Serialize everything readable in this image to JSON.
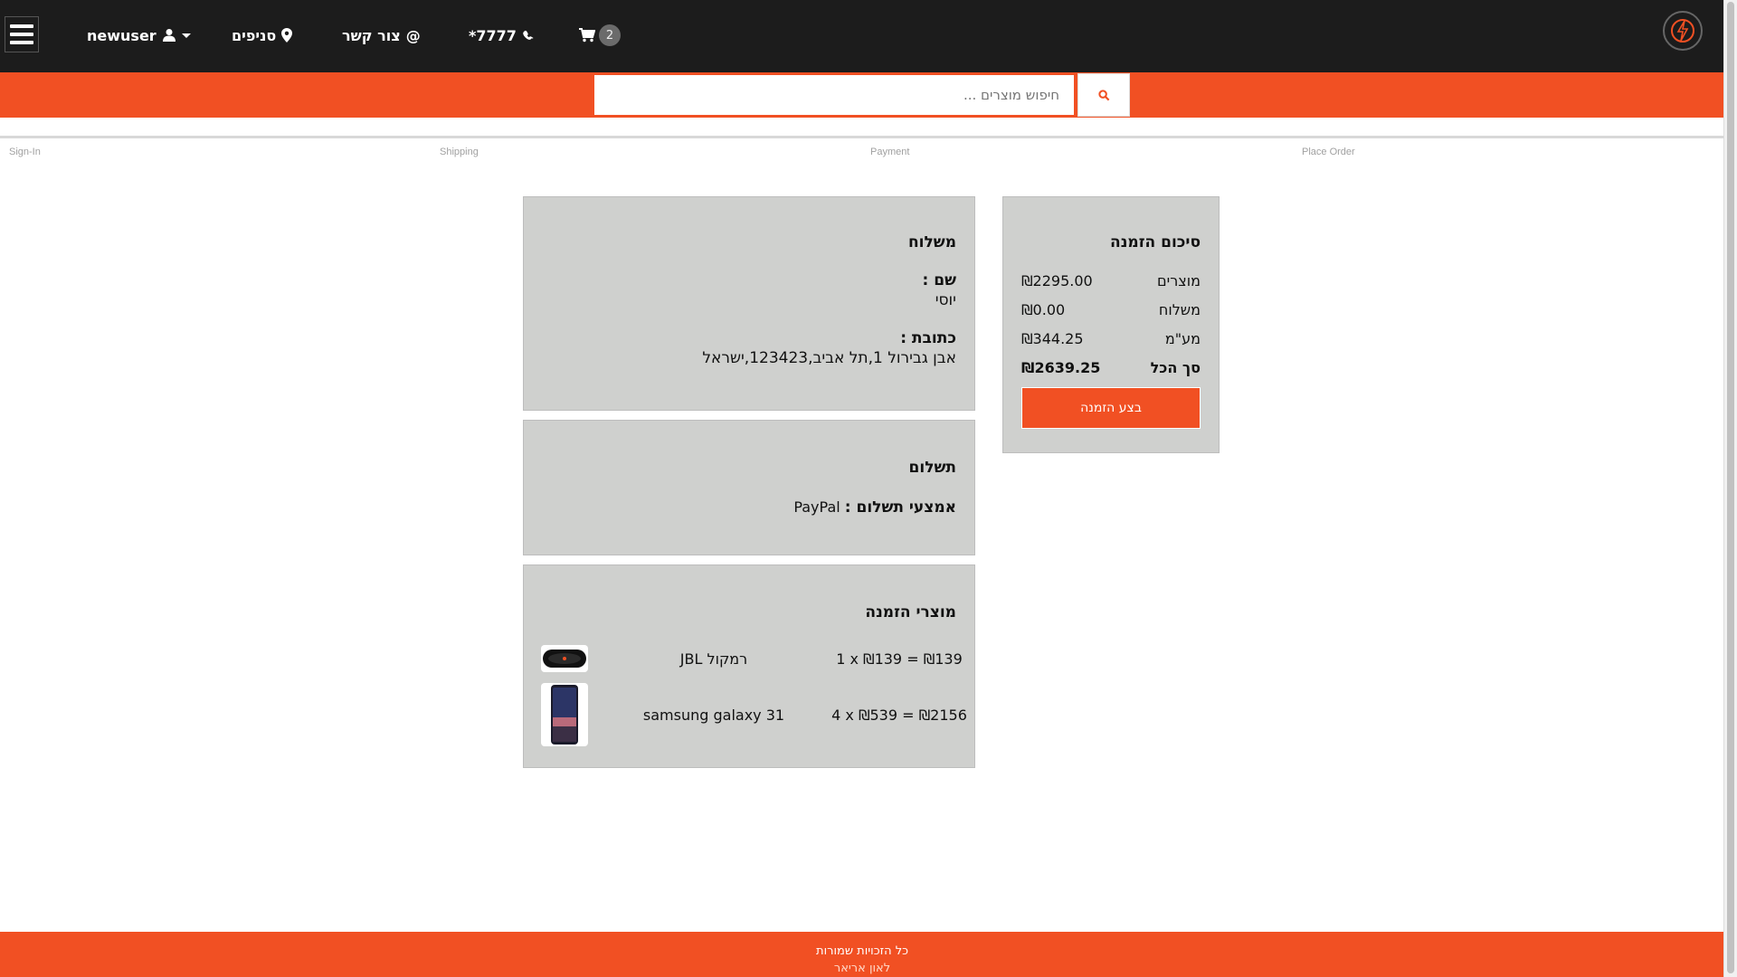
{
  "header": {
    "user_label": "newuser",
    "branches_label": "סניפים",
    "contact_label": "צור קשר",
    "phone_label": "*7777",
    "cart_count": "2"
  },
  "search": {
    "placeholder": "חיפוש מוצרים ..."
  },
  "steps": [
    "Sign-In",
    "Shipping",
    "Payment",
    "Place Order"
  ],
  "shipping": {
    "title": "משלוח",
    "name_label": "שם :",
    "name_value": "יוסי",
    "address_label": "כתובת :",
    "address_value": "אבן גבירול 1,תל אביב,123423,ישראל"
  },
  "payment": {
    "title": "תשלום",
    "method_label": "אמצעי תשלום :",
    "method_value": "PayPal"
  },
  "order_items": {
    "title": "מוצרי הזמנה",
    "items": [
      {
        "name": "JBL רמקול",
        "price_line": "1 x ₪139 = ₪139"
      },
      {
        "name": "samsung galaxy 31",
        "price_line": "4 x ₪539 = ₪2156"
      }
    ]
  },
  "summary": {
    "title": "סיכום הזמנה",
    "rows": [
      {
        "label": "מוצרים",
        "value": "₪2295.00"
      },
      {
        "label": "משלוח",
        "value": "₪0.00"
      },
      {
        "label": "מע\"מ",
        "value": "₪344.25"
      },
      {
        "label": "סך הכל",
        "value": "₪2639.25"
      }
    ],
    "button_label": "בצע הזמנה"
  },
  "footer": {
    "rights": "כל הזכויות שמורות",
    "author": "לאון אריאר"
  },
  "colors": {
    "accent": "#f15023",
    "header_bg": "#1c1c1c",
    "card_bg": "#cfd0ce"
  }
}
